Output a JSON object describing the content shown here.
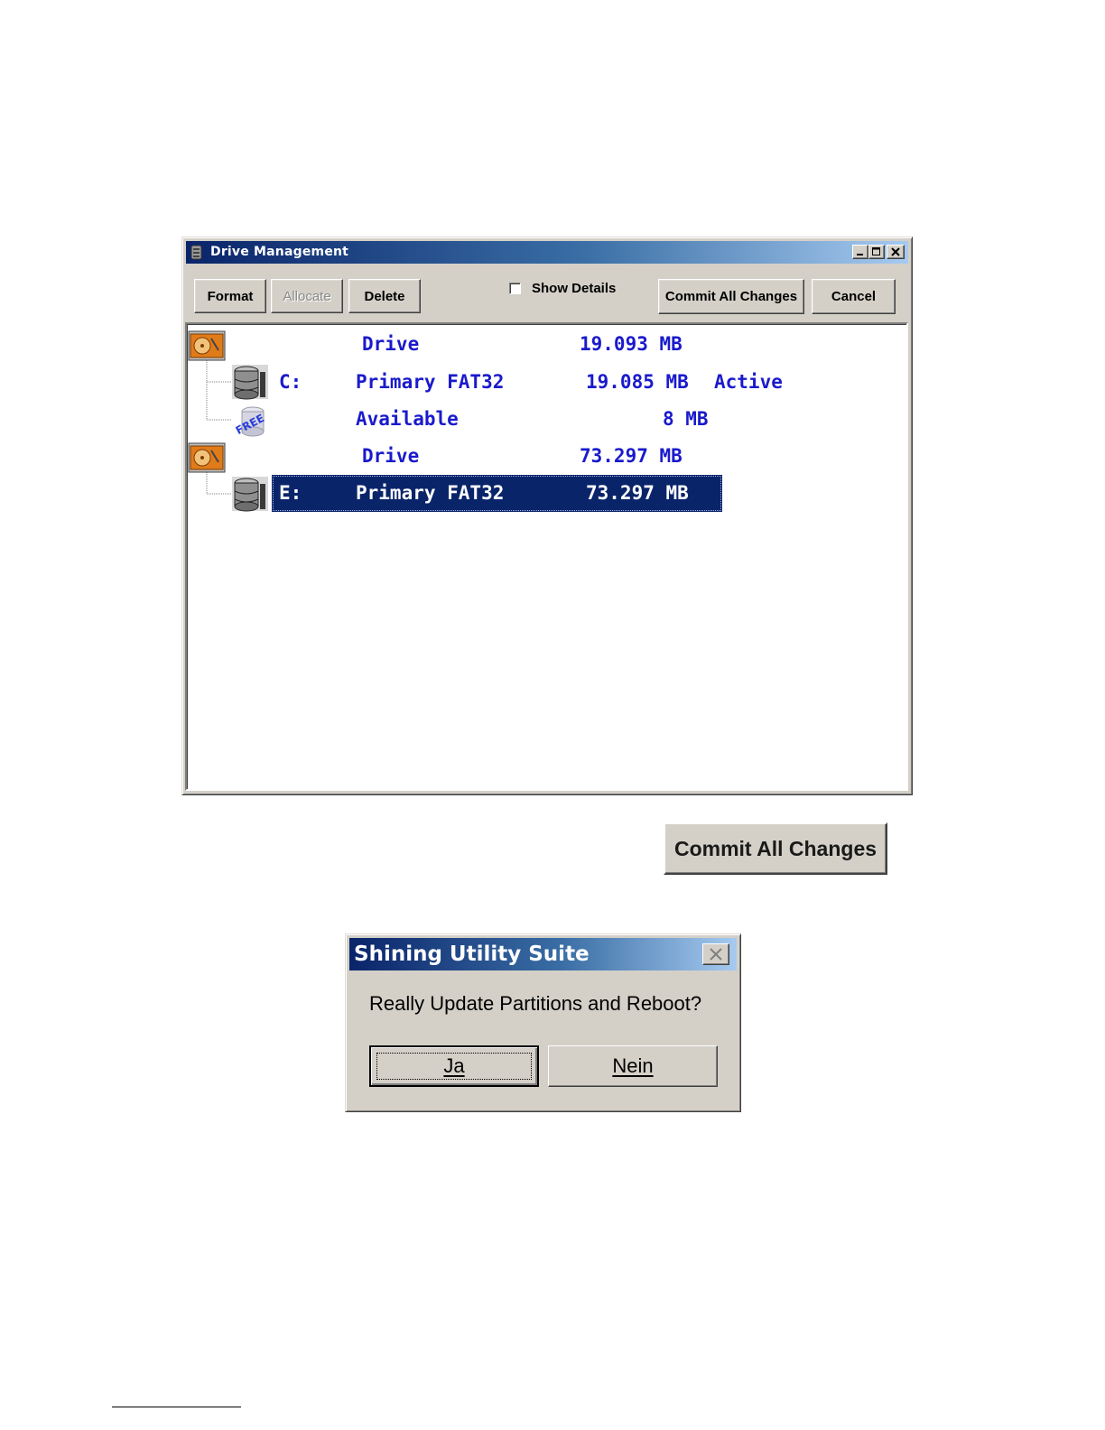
{
  "drive_management": {
    "title": "Drive Management",
    "toolbar": {
      "format_label": "Format",
      "allocate_label": "Allocate",
      "delete_label": "Delete",
      "show_details_label": "Show Details",
      "show_details_checked": false,
      "commit_label": "Commit All Changes",
      "cancel_label": "Cancel"
    },
    "tree": [
      {
        "kind": "drive",
        "icon": "hard-disk-icon",
        "letter": "",
        "type": "Drive",
        "size": "19.093 MB",
        "flag": ""
      },
      {
        "kind": "partition",
        "icon": "database-icon",
        "letter": "C:",
        "type": "Primary FAT32",
        "size": "19.085 MB",
        "flag": "Active"
      },
      {
        "kind": "free",
        "icon": "free-space-icon",
        "letter": "",
        "type": "Available",
        "size": "8 MB",
        "flag": ""
      },
      {
        "kind": "drive",
        "icon": "hard-disk-icon",
        "letter": "",
        "type": "Drive",
        "size": "73.297 MB",
        "flag": ""
      },
      {
        "kind": "partition",
        "icon": "database-icon",
        "letter": "E:",
        "type": "Primary FAT32",
        "size": "73.297 MB",
        "flag": "",
        "selected": true
      }
    ]
  },
  "enlarged_button": {
    "label": "Commit All Changes"
  },
  "confirm_dialog": {
    "title": "Shining Utility Suite",
    "message": "Really Update Partitions and Reboot?",
    "yes_label": "Ja",
    "no_label": "Nein"
  },
  "colors": {
    "title_bar": "#0a246a",
    "tree_text": "#1a1acc",
    "selection": "#0a246a",
    "face": "#d4d0c8"
  }
}
